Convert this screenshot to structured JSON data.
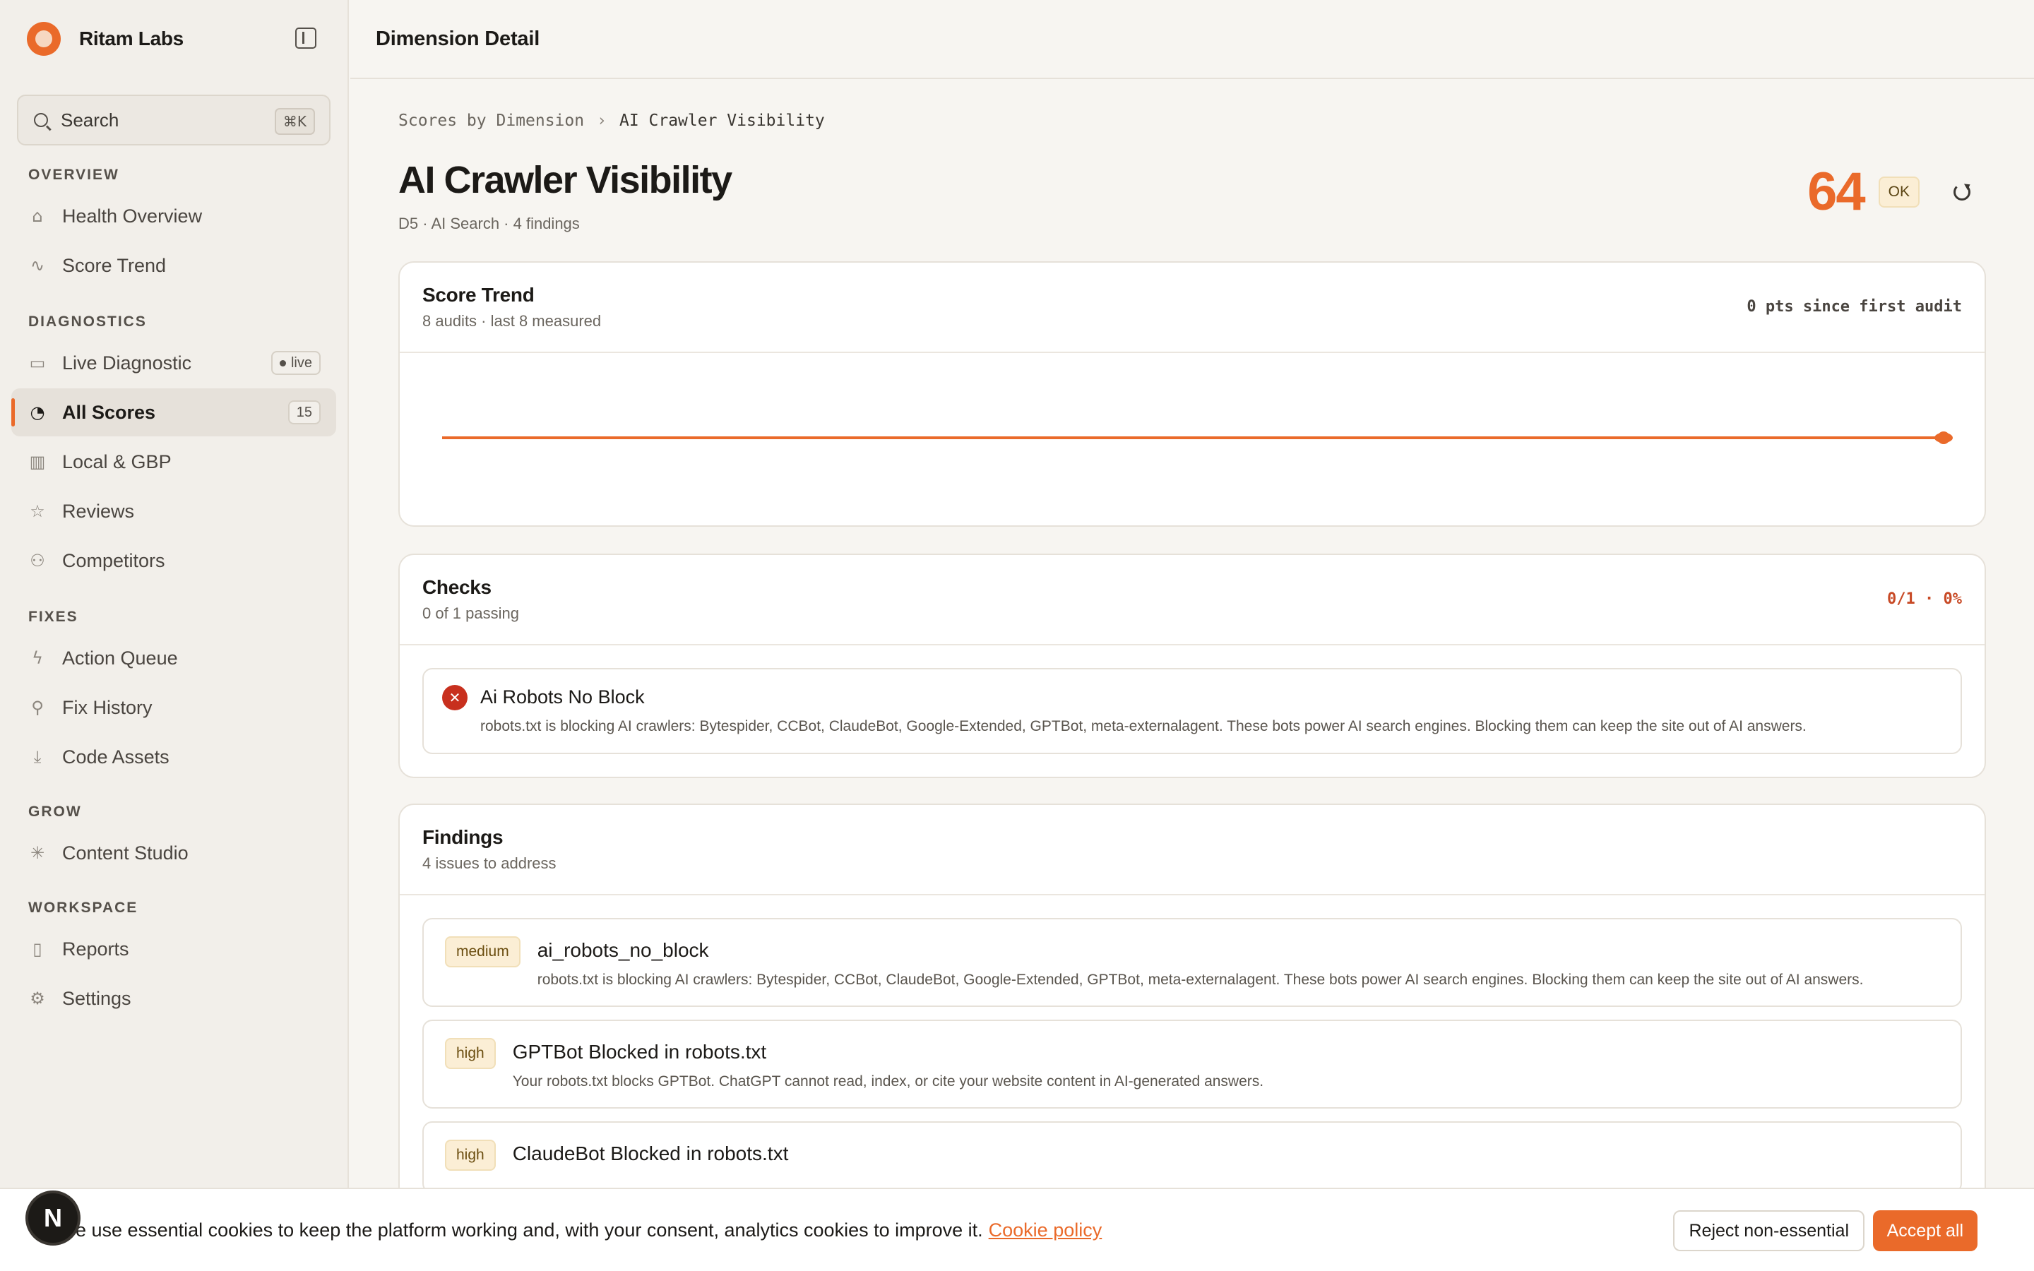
{
  "brand": {
    "name": "Ritam Labs"
  },
  "search": {
    "label": "Search",
    "shortcut": "⌘K"
  },
  "nav": {
    "sections": [
      {
        "title": "OVERVIEW",
        "items": [
          {
            "label": "Health Overview",
            "icon": "home-icon"
          },
          {
            "label": "Score Trend",
            "icon": "activity-icon"
          }
        ]
      },
      {
        "title": "DIAGNOSTICS",
        "items": [
          {
            "label": "Live Diagnostic",
            "icon": "bot-icon",
            "badge": "live"
          },
          {
            "label": "All Scores",
            "icon": "gauge-icon",
            "badge": "15",
            "active": true
          },
          {
            "label": "Local & GBP",
            "icon": "map-icon"
          },
          {
            "label": "Reviews",
            "icon": "star-icon"
          },
          {
            "label": "Competitors",
            "icon": "users-icon"
          }
        ]
      },
      {
        "title": "FIXES",
        "items": [
          {
            "label": "Action Queue",
            "icon": "zap-icon"
          },
          {
            "label": "Fix History",
            "icon": "wrench-icon"
          },
          {
            "label": "Code Assets",
            "icon": "download-icon"
          }
        ]
      },
      {
        "title": "GROW",
        "items": [
          {
            "label": "Content Studio",
            "icon": "sparkle-icon"
          }
        ]
      },
      {
        "title": "WORKSPACE",
        "items": [
          {
            "label": "Reports",
            "icon": "file-icon"
          },
          {
            "label": "Settings",
            "icon": "gear-icon"
          }
        ]
      }
    ]
  },
  "topbar": {
    "title": "Dimension Detail"
  },
  "breadcrumb": {
    "parent": "Scores by Dimension",
    "current": "AI Crawler Visibility"
  },
  "page": {
    "title": "AI Crawler Visibility",
    "subtitle": "D5 · AI Search · 4 findings",
    "score": "64",
    "status": "OK"
  },
  "trend": {
    "title": "Score Trend",
    "subtitle": "8 audits · last 8 measured",
    "delta": "0 pts since first audit",
    "values": [
      64,
      64,
      64,
      64,
      64,
      64,
      64,
      64
    ],
    "color": "#ea6a2a"
  },
  "checks": {
    "title": "Checks",
    "subtitle": "0 of 1 passing",
    "summary": "0/1 · 0%",
    "items": [
      {
        "title": "Ai Robots No Block",
        "description": "robots.txt is blocking AI crawlers: Bytespider, CCBot, ClaudeBot, Google-Extended, GPTBot, meta-externalagent. These bots power AI search engines. Blocking them can keep the site out of AI answers."
      }
    ]
  },
  "findings": {
    "title": "Findings",
    "subtitle": "4 issues to address",
    "items": [
      {
        "severity": "medium",
        "title": "ai_robots_no_block",
        "description": "robots.txt is blocking AI crawlers: Bytespider, CCBot, ClaudeBot, Google-Extended, GPTBot, meta-externalagent. These bots power AI search engines. Blocking them can keep the site out of AI answers."
      },
      {
        "severity": "high",
        "title": "GPTBot Blocked in robots.txt",
        "description": "Your robots.txt blocks GPTBot. ChatGPT cannot read, index, or cite your website content in AI-generated answers."
      },
      {
        "severity": "high",
        "title": "ClaudeBot Blocked in robots.txt",
        "description": ""
      }
    ]
  },
  "cookie": {
    "text": "We use essential cookies to keep the platform working and, with your consent, analytics cookies to improve it.",
    "link": "Cookie policy",
    "reject": "Reject non-essential",
    "accept": "Accept all"
  },
  "avatar": {
    "letter": "N"
  }
}
